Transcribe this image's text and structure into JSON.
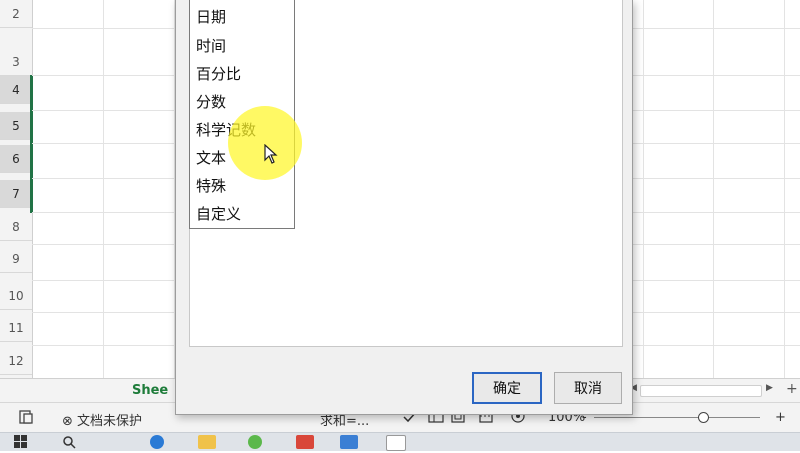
{
  "sheet": {
    "row_numbers": [
      "2",
      "3",
      "4",
      "5",
      "6",
      "7",
      "8",
      "9",
      "10",
      "11",
      "12"
    ],
    "tab_label": "Shee"
  },
  "dialog": {
    "categories": [
      "日期",
      "时间",
      "百分比",
      "分数",
      "科学记数",
      "文本",
      "特殊",
      "自定义"
    ],
    "ok_label": "确定",
    "cancel_label": "取消"
  },
  "statusbar": {
    "protect_text": "文档未保护",
    "sum_text": "求和=...",
    "zoom_text": "100%",
    "zoom_minus": "-",
    "zoom_plus": "+"
  },
  "colors": {
    "accent_green": "#217346",
    "highlight": "#fff728",
    "default_button_border": "#2b66c3"
  },
  "icons": [
    "sheet-view-icon",
    "shield-icon",
    "accessibility-icon",
    "normal-view-icon",
    "page-layout-icon",
    "page-break-icon",
    "windows-start-icon",
    "search-icon",
    "edge-icon",
    "folder-icon",
    "wechat-icon",
    "app-icon",
    "excel-icon",
    "notepad-icon"
  ]
}
